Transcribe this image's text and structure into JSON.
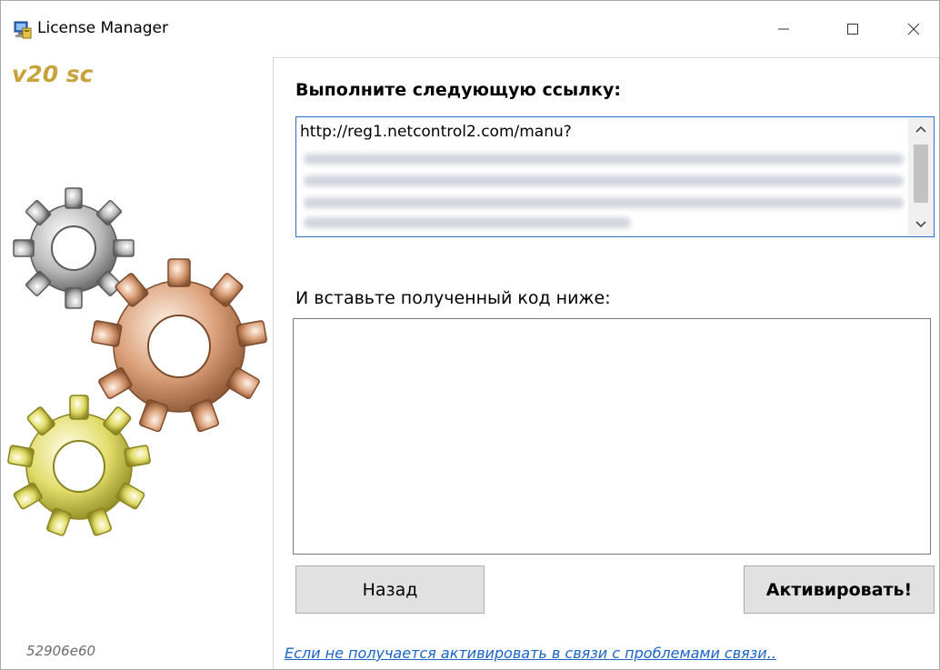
{
  "window": {
    "title": "License Manager",
    "minimize_glyph": "—",
    "maximize_glyph": "☐",
    "close_glyph": "✕"
  },
  "sidebar": {
    "version": "v20 sc",
    "machine_id": "52906e60",
    "gear_colors": [
      "#8a8a8a",
      "#c9885c",
      "#c9c34a"
    ]
  },
  "main": {
    "heading": "Выполните следующую ссылку:",
    "url_value": "http://reg1.netcontrol2.com/manu?",
    "paste_label": "И вставьте полученный код ниже:",
    "code_value": "",
    "back_label": "Назад",
    "activate_label": "Активировать!",
    "help_link": "Если не получается активировать в связи с проблемами связи.."
  },
  "colors": {
    "accent": "#2a6fc8",
    "link": "#1a63c9",
    "version_gold": "#c8a23a"
  }
}
